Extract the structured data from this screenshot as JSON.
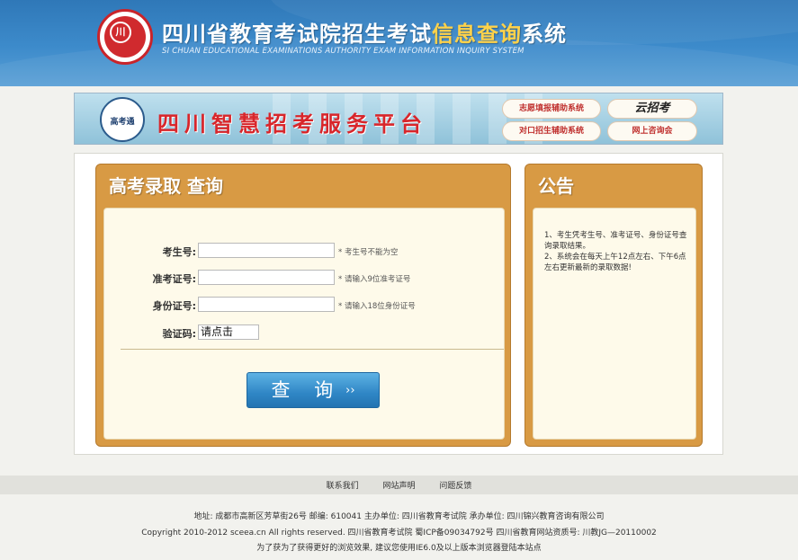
{
  "header": {
    "logo_text": "川",
    "title_part1": "四川省教育考试院招生考试",
    "title_highlight": "信息查询",
    "title_part2": "系统",
    "subtitle": "SI CHUAN EDUCATIONAL EXAMINATIONS AUTHORITY EXAM INFORMATION INQUIRY SYSTEM"
  },
  "banner": {
    "logo_text": "高考通",
    "title": "四川智慧招考服务平台",
    "btn_volunteer": "志愿填报辅助系统",
    "btn_cloud": "云招考",
    "btn_counterpart": "对口招生辅助系统",
    "btn_online": "网上咨询会"
  },
  "query_panel": {
    "title": "高考录取 查询",
    "exam_no_label": "考生号:",
    "exam_no_value": "",
    "exam_no_hint": "* 考生号不能为空",
    "ticket_label": "准考证号:",
    "ticket_value": "",
    "ticket_hint": "* 请输入9位准考证号",
    "id_label": "身份证号:",
    "id_value": "",
    "id_hint": "* 请输入18位身份证号",
    "captcha_label": "验证码:",
    "captcha_value": "请点击",
    "submit_label": "查 询",
    "submit_icon": "double-chevron-right-icon"
  },
  "notice_panel": {
    "title": "公告",
    "line1": "1、考生凭考生号、准考证号、身份证号查询录取结果。",
    "line2": "2、系统会在每天上午12点左右、下午6点左右更新最新的录取数据!"
  },
  "footer": {
    "links": [
      "联系我们",
      "网站声明",
      "问题反馈"
    ],
    "address": "地址: 成都市高新区芳草街26号 邮编: 610041     主办单位: 四川省教育考试院  承办单位: 四川锦兴教育咨询有限公司",
    "copyright": "Copyright 2010-2012 sceea.cn All rights reserved. 四川省教育考试院     蜀ICP备09034792号 四川省教育网站资质号: 川教JG—20110002",
    "browser_tip": "为了获为了获得更好的浏览效果, 建议您使用IE6.0及以上版本浏览器登陆本站点"
  }
}
